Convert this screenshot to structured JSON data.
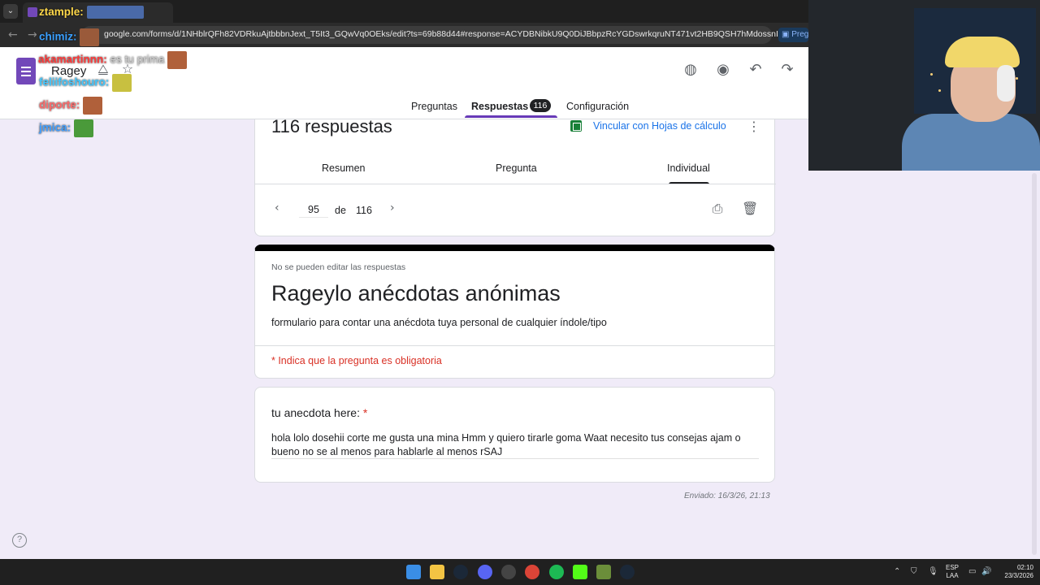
{
  "browser": {
    "url": "google.com/forms/d/1NHblrQFh82VDRkuAjtbbbnJext_T5It3_GQwVq0OEks/edit?ts=69b88d44#response=ACYDBNibkU9Q0DiJBbpzRcYGDswrkqruNT471vt2HB9QSH7hMdossnIf7JuNQtMjkgZTbQk",
    "ext_label": "Preg"
  },
  "header": {
    "doc_title": "Ragey",
    "tabs": [
      "Preguntas",
      "Respuestas",
      "Configuración"
    ],
    "responses_badge": "116",
    "icons": [
      "palette-icon",
      "eye-icon",
      "undo-icon",
      "redo-icon"
    ]
  },
  "summary": {
    "count_label": "116 respuestas",
    "sheets_link": "Vincular con Hojas de cálculo",
    "subtabs": [
      "Resumen",
      "Pregunta",
      "Individual"
    ],
    "active_subtab": "Individual",
    "pager": {
      "current": "95",
      "of_label": "de",
      "total": "116"
    }
  },
  "form": {
    "no_edit_note": "No se pueden editar las respuestas",
    "title": "Rageylo anécdotas anónimas",
    "description": "formulario para contar una anécdota tuya personal de cualquier índole/tipo",
    "required_note": "* Indica que la pregunta es obligatoria"
  },
  "answer": {
    "question": "tu anecdota here: ",
    "required_star": "*",
    "text": "hola lolo dosehii corte me gusta una mina Hmm y quiero tirarle goma Waat necesito tus consejas ajam o bueno no se al menos para hablarle al menos rSAJ",
    "submitted": "Enviado: 16/3/26, 21:13"
  },
  "chat": {
    "messages": [
      {
        "user": "ztample:",
        "msg": "",
        "color": "#ffd84a"
      },
      {
        "user": "chimiz:",
        "msg": "",
        "color": "#3aa0ff"
      },
      {
        "user": "akamartinnn:",
        "msg": "es tu prima",
        "color": "#ff3b3b"
      },
      {
        "user": "feliifoshouro:",
        "msg": "",
        "color": "#44c8ff"
      },
      {
        "user": "diporte:",
        "msg": "",
        "color": "#ff6b6b"
      },
      {
        "user": "jmica:",
        "msg": "",
        "color": "#44a0ff"
      }
    ]
  },
  "taskbar": {
    "lang_top": "ESP",
    "lang_bottom": "LAA",
    "time": "02:10",
    "date": "23/3/2026"
  },
  "colors": {
    "accent": "#673ab7",
    "background": "#f0ebf8",
    "link": "#1a73e8",
    "required": "#d93025"
  }
}
